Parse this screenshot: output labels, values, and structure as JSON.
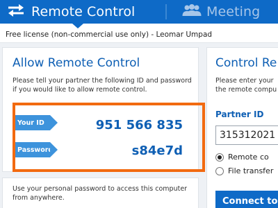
{
  "header": {
    "tabs": [
      {
        "label": "Remote Control",
        "icon": "arrows-icon",
        "active": true
      },
      {
        "label": "Meeting",
        "icon": "people-icon",
        "active": false
      }
    ],
    "colors": {
      "bar": "#0e6ac7",
      "inactive_text": "#a7c6e9"
    }
  },
  "license": {
    "text": "Free license (non-commercial use only) - Leomar Umpad"
  },
  "allow_panel": {
    "title": "Allow Remote Control",
    "description": "Please tell your partner the following ID and password if you would like to allow remote control.",
    "id_label": "Your ID",
    "id_value": "951 566 835",
    "password_label": "Password",
    "password_value": "s84e7d",
    "highlight_color": "#f26a10"
  },
  "personal_panel": {
    "description": "Use your personal password to access this computer from anywhere."
  },
  "control_panel": {
    "title": "Control Re",
    "description_line1": "Please enter your",
    "description_line2": "the remote compu",
    "partner_id_label": "Partner ID",
    "partner_id_value": "315312021",
    "options": [
      {
        "label": "Remote co",
        "selected": true
      },
      {
        "label": "File transfer",
        "selected": false
      }
    ],
    "connect_label": "Connect to p"
  }
}
